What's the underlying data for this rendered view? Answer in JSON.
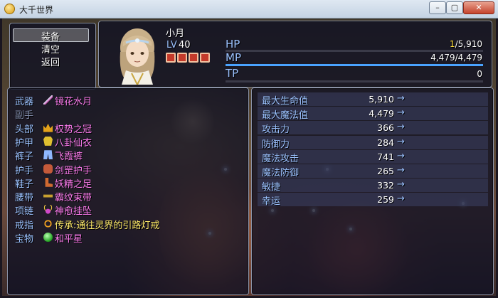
{
  "window": {
    "title": "大千世界",
    "min_glyph": "–",
    "max_glyph": "▢",
    "close_glyph": "✕"
  },
  "commands": [
    {
      "label": "装备",
      "selected": true
    },
    {
      "label": "清空",
      "selected": false
    },
    {
      "label": "返回",
      "selected": false
    }
  ],
  "actor": {
    "name": "小月",
    "level_label": "LV",
    "level": "40",
    "status_icons": [
      "demon-face-icon",
      "demon-face-icon",
      "demon-face-icon",
      "demon-face-icon"
    ],
    "hp": {
      "label": "HP",
      "current": "1",
      "max": "5,910",
      "ratio": 0.0002,
      "color": "#ff7a3a"
    },
    "mp": {
      "label": "MP",
      "current": "4,479",
      "max": "4,479",
      "ratio": 1.0,
      "color": "#4aa3ff"
    },
    "tp": {
      "label": "TP",
      "value": "0",
      "ratio": 0,
      "color": "#7cff7c"
    }
  },
  "equipment": [
    {
      "slot": "武器",
      "item": "镜花水月",
      "icon": "sword-icon",
      "item_color": "#ff7cf0",
      "slot_dim": false
    },
    {
      "slot": "副手",
      "item": "",
      "icon": "",
      "item_color": "#ffffff",
      "slot_dim": true
    },
    {
      "slot": "头部",
      "item": "权势之冠",
      "icon": "crown-icon",
      "item_color": "#ff7cf0",
      "slot_dim": false
    },
    {
      "slot": "护甲",
      "item": "八卦仙衣",
      "icon": "robe-icon",
      "item_color": "#ff7cf0",
      "slot_dim": false
    },
    {
      "slot": "裤子",
      "item": "飞霞裤",
      "icon": "pants-icon",
      "item_color": "#ff7cf0",
      "slot_dim": false
    },
    {
      "slot": "护手",
      "item": "剑罡护手",
      "icon": "gauntlet-icon",
      "item_color": "#ff7cf0",
      "slot_dim": false
    },
    {
      "slot": "鞋子",
      "item": "妖精之足",
      "icon": "boots-icon",
      "item_color": "#ff7cf0",
      "slot_dim": false
    },
    {
      "slot": "腰带",
      "item": "霸纹束带",
      "icon": "belt-icon",
      "item_color": "#ff7cf0",
      "slot_dim": false
    },
    {
      "slot": "项链",
      "item": "神愈挂坠",
      "icon": "pendant-icon",
      "item_color": "#ff7cf0",
      "slot_dim": false
    },
    {
      "slot": "戒指",
      "item": "传承:通往灵界的引路灯戒",
      "icon": "ring-icon",
      "item_color": "#ffeb6a",
      "slot_dim": false
    },
    {
      "slot": "宝物",
      "item": "和平星",
      "icon": "orb-icon",
      "item_color": "#ff7cf0",
      "slot_dim": false
    }
  ],
  "stats": [
    {
      "name": "最大生命值",
      "value": "5,910",
      "arrow": "→"
    },
    {
      "name": "最大魔法值",
      "value": "4,479",
      "arrow": "→"
    },
    {
      "name": "攻击力",
      "value": "366",
      "arrow": "→"
    },
    {
      "name": "防御力",
      "value": "284",
      "arrow": "→"
    },
    {
      "name": "魔法攻击",
      "value": "741",
      "arrow": "→"
    },
    {
      "name": "魔法防御",
      "value": "265",
      "arrow": "→"
    },
    {
      "name": "敏捷",
      "value": "332",
      "arrow": "→"
    },
    {
      "name": "幸运",
      "value": "259",
      "arrow": "→"
    }
  ]
}
